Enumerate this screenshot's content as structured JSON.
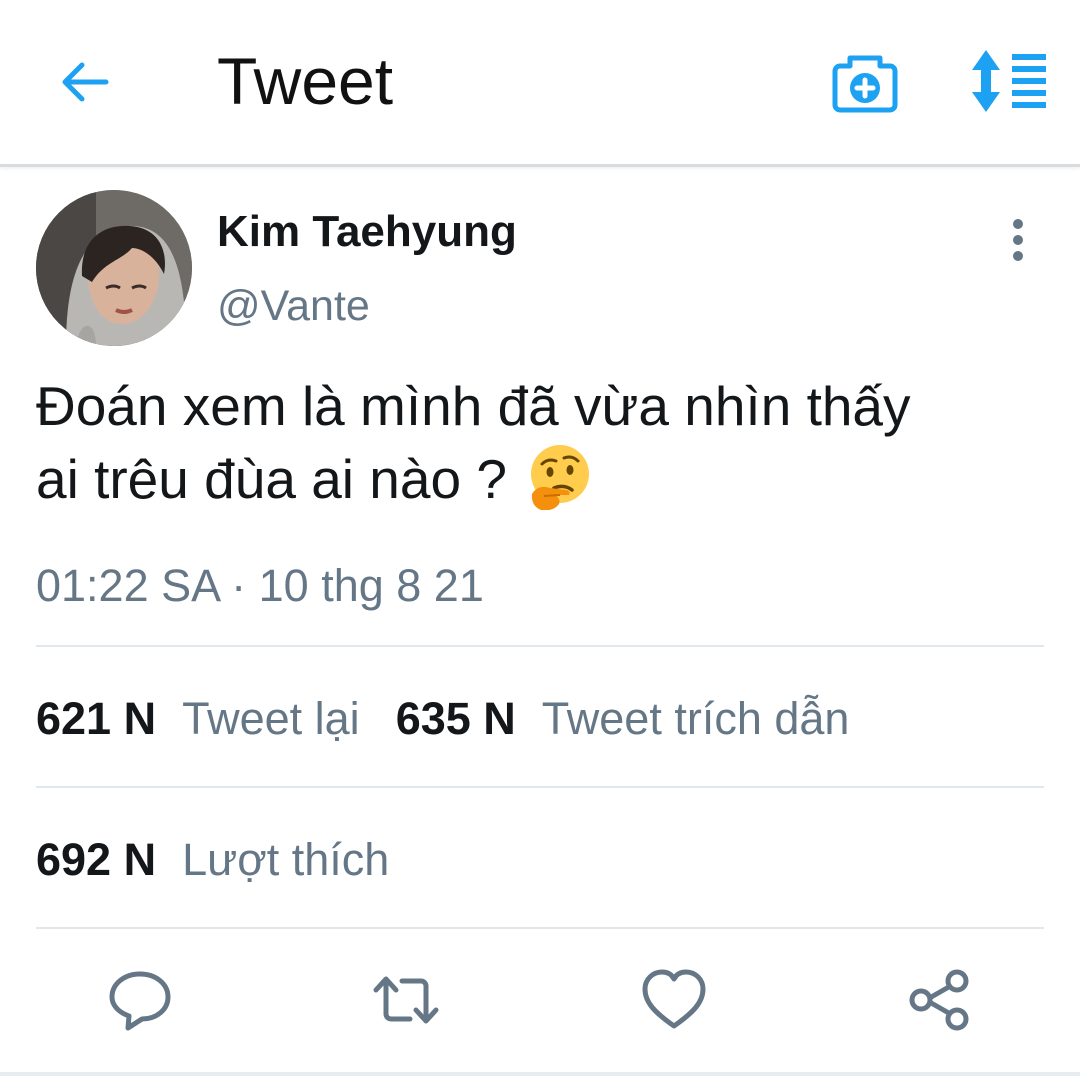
{
  "header": {
    "title": "Tweet",
    "back_icon": "arrow-left-icon",
    "camera_icon": "camera-plus-icon",
    "sort_icon": "sort-list-icon",
    "accent_color": "#1da1f2"
  },
  "tweet": {
    "author_name": "Kim Taehyung",
    "author_handle": "@Vante",
    "text_line_1": "Đoán xem là mình đã vừa nhìn thấy",
    "text_line_2": "ai trêu đùa ai nào ?",
    "emoji": "thinking-face-icon",
    "timestamp": "01:22 SA · 10 thg 8 21"
  },
  "stats": {
    "retweets_count": "621 N",
    "retweets_label": "Tweet lại",
    "quotes_count": "635 N",
    "quotes_label": "Tweet trích dẫn",
    "likes_count": "692 N",
    "likes_label": "Lượt thích"
  },
  "actions": {
    "reply_icon": "reply-icon",
    "retweet_icon": "retweet-icon",
    "like_icon": "heart-icon",
    "share_icon": "share-icon",
    "icon_color": "#657786"
  }
}
